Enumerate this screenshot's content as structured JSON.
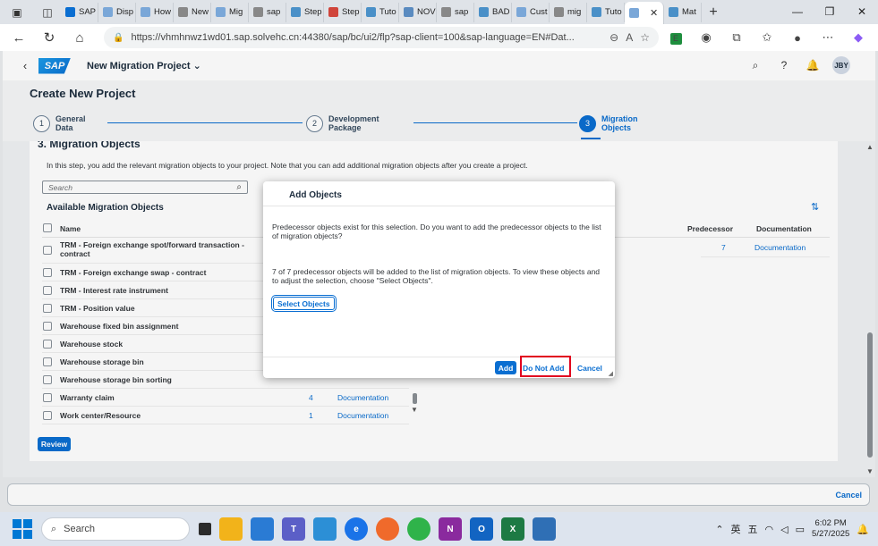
{
  "browser": {
    "tabs": [
      {
        "label": "SAP",
        "color": "#0a6ed1"
      },
      {
        "label": "Disp",
        "color": "#7aa7d8"
      },
      {
        "label": "How",
        "color": "#7aa7d8"
      },
      {
        "label": "New",
        "color": "#888888"
      },
      {
        "label": "Mig",
        "color": "#7aa7d8"
      },
      {
        "label": "sap",
        "color": "#888888"
      },
      {
        "label": "Step",
        "color": "#4a90c8"
      },
      {
        "label": "Step",
        "color": "#d0453b"
      },
      {
        "label": "Tuto",
        "color": "#4a90c8"
      },
      {
        "label": "NOV",
        "color": "#5a8bc0"
      },
      {
        "label": "sap",
        "color": "#888888"
      },
      {
        "label": "BAD",
        "color": "#4a90c8"
      },
      {
        "label": "Cust",
        "color": "#7aa7d8"
      },
      {
        "label": "mig",
        "color": "#888888"
      },
      {
        "label": "Tuto",
        "color": "#4a90c8"
      },
      {
        "label": "",
        "color": "#7aa7d8",
        "active": true
      },
      {
        "label": "Mat",
        "color": "#4a90c8"
      }
    ],
    "url": "https://vhmhnwz1wd01.sap.solvehc.cn:44380/sap/bc/ui2/flp?sap-client=100&sap-language=EN#Dat..."
  },
  "shell": {
    "logo": "SAP",
    "app_title": "New Migration Project",
    "title_caret": "⌄",
    "user_initials": "JBY"
  },
  "wizard": {
    "page_title": "Create New Project",
    "steps": [
      {
        "num": "1",
        "label": "General Data"
      },
      {
        "num": "2",
        "label": "Development Package"
      },
      {
        "num": "3",
        "label": "Migration Objects"
      }
    ]
  },
  "section": {
    "title": "3. Migration Objects",
    "description": "In this step, you add the relevant migration objects to your project. Note that you can add additional migration objects after you create a project.",
    "search_placeholder": "Search",
    "available_title": "Available Migration Objects",
    "columns": {
      "name": "Name",
      "predecessor": "Predecessor",
      "documentation": "Documentation"
    },
    "rows": [
      {
        "name": "TRM - Foreign exchange spot/forward transaction - contract",
        "pred": "",
        "doc": ""
      },
      {
        "name": "TRM - Foreign exchange swap - contract",
        "pred": "",
        "doc": ""
      },
      {
        "name": "TRM - Interest rate instrument",
        "pred": "",
        "doc": ""
      },
      {
        "name": "TRM - Position value",
        "pred": "",
        "doc": ""
      },
      {
        "name": "Warehouse fixed bin assignment",
        "pred": "",
        "doc": ""
      },
      {
        "name": "Warehouse stock",
        "pred": "",
        "doc": ""
      },
      {
        "name": "Warehouse storage bin",
        "pred": "",
        "doc": ""
      },
      {
        "name": "Warehouse storage bin sorting",
        "pred": "",
        "doc": ""
      },
      {
        "name": "Warranty claim",
        "pred": "4",
        "doc": "Documentation"
      },
      {
        "name": "Work center/Resource",
        "pred": "1",
        "doc": "Documentation"
      }
    ],
    "first_row_right": {
      "pred": "7",
      "doc": "Documentation"
    },
    "review_label": "Review"
  },
  "footer": {
    "cancel_label": "Cancel"
  },
  "dialog": {
    "title": "Add Objects",
    "message1": "Predecessor objects exist for this selection. Do you want to add the predecessor objects to the list of migration objects?",
    "message2": "7 of 7 predecessor objects will be added to the list of migration objects. To view these objects and to adjust the selection, choose \"Select Objects\".",
    "select_objects_label": "Select Objects",
    "add_label": "Add",
    "do_not_add_label": "Do Not Add",
    "cancel_label": "Cancel"
  },
  "taskbar": {
    "search_label": "Search",
    "tray_lang": "英",
    "tray_ime": "五",
    "time": "6:02 PM",
    "date": "5/27/2025"
  }
}
